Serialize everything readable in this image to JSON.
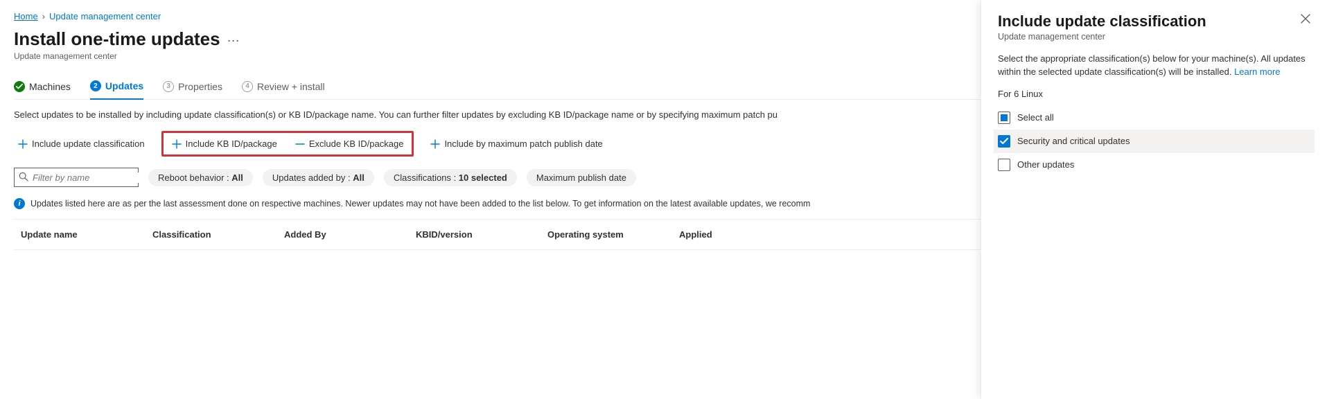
{
  "breadcrumb": {
    "home": "Home",
    "parent": "Update management center"
  },
  "page": {
    "title": "Install one-time updates",
    "subtitle": "Update management center "
  },
  "steps": {
    "s1": {
      "label": "Machines"
    },
    "s2": {
      "num": "2",
      "label": "Updates"
    },
    "s3": {
      "num": "3",
      "label": "Properties"
    },
    "s4": {
      "num": "4",
      "label": "Review + install"
    }
  },
  "helper": "Select updates to be installed by including update classification(s) or KB ID/package name. You can further filter updates by excluding KB ID/package name or by specifying maximum patch pu",
  "actions": {
    "include_class": "Include update classification",
    "include_kb": "Include KB ID/package",
    "exclude_kb": "Exclude KB ID/package",
    "include_max": "Include by maximum patch publish date"
  },
  "filters": {
    "search_placeholder": "Filter by name",
    "reboot_label": "Reboot behavior : ",
    "reboot_value": "All",
    "added_label": "Updates added by : ",
    "added_value": "All",
    "class_label": "Classifications : ",
    "class_value": "10 selected",
    "maxpub_label": "Maximum publish date"
  },
  "info": "Updates listed here are as per the last assessment done on respective machines. Newer updates may not have been added to the list below. To get information on the latest available updates, we recomm",
  "columns": {
    "c1": "Update name",
    "c2": "Classification",
    "c3": "Added By",
    "c4": "KBID/version",
    "c5": "Operating system",
    "c6": "Applied"
  },
  "panel": {
    "title": "Include update classification",
    "subtitle": "Update management center",
    "desc_a": "Select the appropriate classification(s) below for your machine(s). All updates within the selected update classification(s) will be installed. ",
    "learn": "Learn more",
    "for": "For 6 Linux",
    "select_all": "Select all",
    "opt1": "Security and critical updates",
    "opt2": "Other updates"
  }
}
